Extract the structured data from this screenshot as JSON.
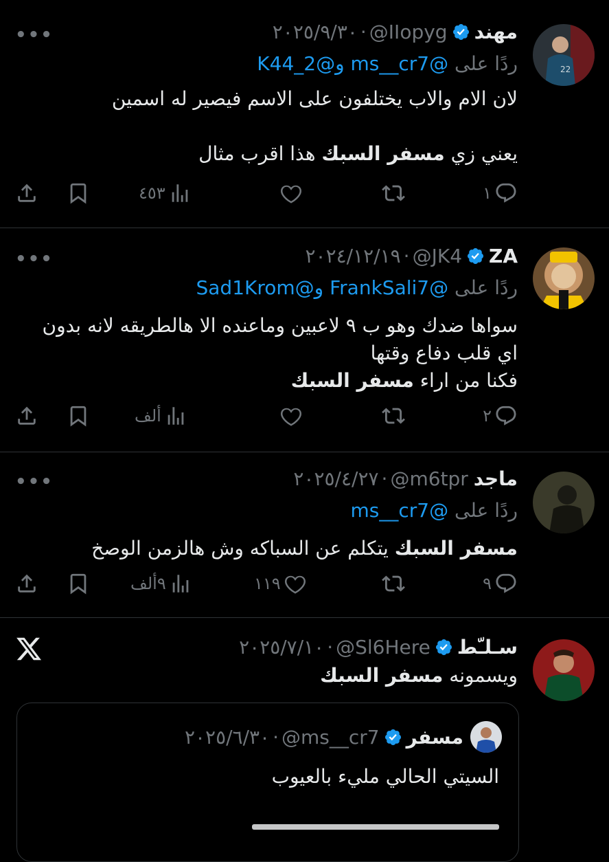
{
  "tweets": [
    {
      "name": "مهند",
      "handle": "@IIopyg",
      "date": "٢٠٢٥/٩/٣٠",
      "replying_label": "ردًا على",
      "replying_mentions": "@ms__cr7 و@2_K44",
      "body_before": "لان الام والاب يختلفون على الاسم فيصير له اسمين\n\nيعني زي ",
      "body_bold": "مسفر السبك",
      "body_after": " هذا اقرب مثال",
      "replies": "١",
      "retweets": "",
      "likes": "",
      "views": "٤٥٣"
    },
    {
      "name": "ZA",
      "handle": "@JK4",
      "date": "٢٠٢٤/١٢/١٩",
      "replying_label": "ردًا على",
      "replying_mentions": "@FrankSali7 و@Sad1Krom",
      "body_before": "سواها ضدك وهو ب ٩ لاعبين وماعنده الا هالطريقه لانه بدون\nاي قلب دفاع وقتها\nفكنا من اراء ",
      "body_bold": "مسفر السبك",
      "body_after": "",
      "replies": "٢",
      "retweets": "",
      "likes": "",
      "views": "ألف"
    },
    {
      "name": "ماجد",
      "handle": "@m6tpr",
      "date": "٢٠٢٥/٤/٢٧",
      "replying_label": "ردًا على",
      "replying_mentions": "@ms__cr7",
      "body_before": "",
      "body_bold": "مسفر السبك",
      "body_after": " يتكلم عن السباكه وش هالزمن الوصخ",
      "replies": "٩",
      "retweets": "",
      "likes": "١١٩",
      "views": "٩ألف"
    },
    {
      "name": "سـلـّط",
      "handle": "@Sl6Here",
      "date": "٢٠٢٥/٧/١٠",
      "body_before": "ويسمونه ",
      "body_bold": "مسفر السبك",
      "body_after": ""
    }
  ],
  "quote": {
    "name": "مسفر",
    "handle": "@ms__cr7",
    "date": "٢٠٢٥/٦/٣٠",
    "body": "السيتي الحالي مليء بالعيوب"
  },
  "colors": {
    "background": "#000000",
    "text": "#e7e9ea",
    "muted": "#71767b",
    "link": "#1d9bf0",
    "verified": "#1d9bf0"
  }
}
